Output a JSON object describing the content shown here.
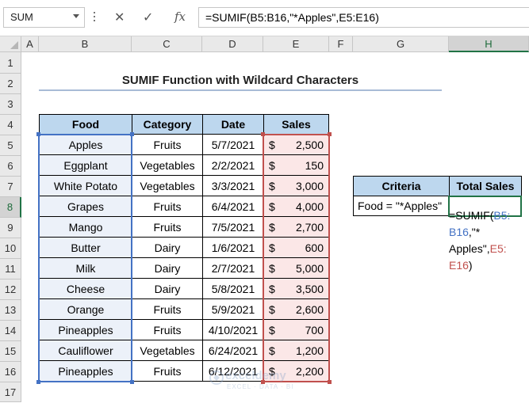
{
  "formula_bar": {
    "name_box": "SUM",
    "cancel_symbol": "✕",
    "enter_symbol": "✓",
    "fx_label": "fx",
    "formula": "=SUMIF(B5:B16,\"*Apples\",E5:E16)"
  },
  "columns": [
    "A",
    "B",
    "C",
    "D",
    "E",
    "F",
    "G",
    "H"
  ],
  "rows": [
    "1",
    "2",
    "3",
    "4",
    "5",
    "6",
    "7",
    "8",
    "9",
    "10",
    "11",
    "12",
    "13",
    "14",
    "15",
    "16",
    "17"
  ],
  "title": "SUMIF Function with Wildcard Characters",
  "table": {
    "headers": [
      "Food",
      "Category",
      "Date",
      "Sales"
    ],
    "rows": [
      {
        "food": "Apples",
        "category": "Fruits",
        "date": "5/7/2021",
        "sales": "2,500"
      },
      {
        "food": "Eggplant",
        "category": "Vegetables",
        "date": "2/2/2021",
        "sales": "150"
      },
      {
        "food": "White Potato",
        "category": "Vegetables",
        "date": "3/3/2021",
        "sales": "3,000"
      },
      {
        "food": "Grapes",
        "category": "Fruits",
        "date": "6/4/2021",
        "sales": "4,000"
      },
      {
        "food": "Mango",
        "category": "Fruits",
        "date": "7/5/2021",
        "sales": "2,700"
      },
      {
        "food": "Butter",
        "category": "Dairy",
        "date": "1/6/2021",
        "sales": "600"
      },
      {
        "food": "Milk",
        "category": "Dairy",
        "date": "2/7/2021",
        "sales": "5,000"
      },
      {
        "food": "Cheese",
        "category": "Dairy",
        "date": "5/8/2021",
        "sales": "3,500"
      },
      {
        "food": "Orange",
        "category": "Fruits",
        "date": "5/9/2021",
        "sales": "2,600"
      },
      {
        "food": "Pineapples",
        "category": "Fruits",
        "date": "4/10/2021",
        "sales": "700"
      },
      {
        "food": "Cauliflower",
        "category": "Vegetables",
        "date": "6/24/2021",
        "sales": "1,200"
      },
      {
        "food": "Pineapples",
        "category": "Fruits",
        "date": "6/12/2021",
        "sales": "2,200"
      }
    ],
    "currency": "$"
  },
  "criteria": {
    "header_criteria": "Criteria",
    "header_total": "Total Sales",
    "criteria_value": "Food = \"*Apples\"",
    "editor_parts": {
      "p1": "=SUMIF(",
      "p2": "B5:",
      "p3": "B16",
      "p4": ",\"*",
      "p5": "Apples\",",
      "p6": "E5:",
      "p7": "E16",
      "p8": ")"
    }
  },
  "watermark": {
    "name": "exceldemy",
    "tagline": "EXCEL · DATA · BI"
  },
  "colors": {
    "header_fill": "#bdd7ee",
    "food_fill": "#ecf1f9",
    "sales_fill": "#fbe7e7",
    "range_blue": "#4472c4",
    "range_red": "#c0504d",
    "active_green": "#217346"
  }
}
